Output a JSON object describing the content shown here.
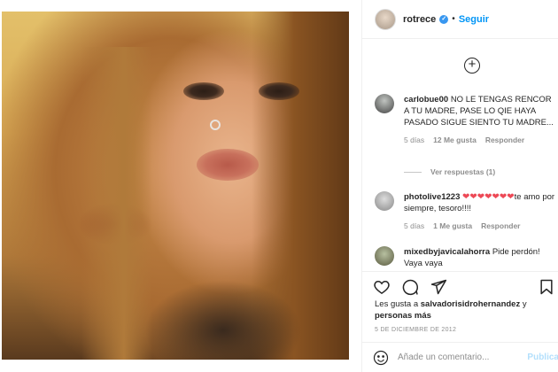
{
  "header": {
    "username": "rotrece",
    "verified_mark": "✓",
    "separator": "•",
    "follow_label": "Seguir"
  },
  "comments_panel": {
    "load_more_symbol": "+",
    "comments": [
      {
        "username": "carlobue00",
        "text": "NO LE TENGAS RENCOR A TU MADRE, PASE LO QIE HAYA PASADO SIGUE SIENTO TU MADRE...",
        "time": "5 días",
        "likes": "12 Me gusta",
        "reply_label": "Responder",
        "more_symbol": "···"
      },
      {
        "username": "photolive1223",
        "hearts": "❤❤❤❤❤❤❤",
        "text": "te amo por siempre, tesoro!!!!",
        "time": "5 días",
        "likes": "1 Me gusta",
        "reply_label": "Responder"
      },
      {
        "username": "mixedbyjavicalahorra",
        "text": "Pide perdón! Vaya vaya"
      }
    ],
    "view_replies_label": "Ver respuestas (1)"
  },
  "actions": {
    "liked_by_prefix": "Les gusta a",
    "liked_by_user": "salvadorisidrohernandez",
    "liked_by_join": "y",
    "liked_by_others": "personas más",
    "date": "5 DE DICIEMBRE DE 2012",
    "icons": [
      "heart-icon",
      "comment-icon",
      "share-icon",
      "bookmark-icon"
    ]
  },
  "add_comment": {
    "placeholder": "Añade un comentario...",
    "publish_label": "Publica"
  },
  "colors": {
    "accent": "#0095f6",
    "verified": "#3897f0",
    "hearts": "#ed4956",
    "publish_disabled": "#b2dffc",
    "muted_text": "#8e8e8e"
  }
}
